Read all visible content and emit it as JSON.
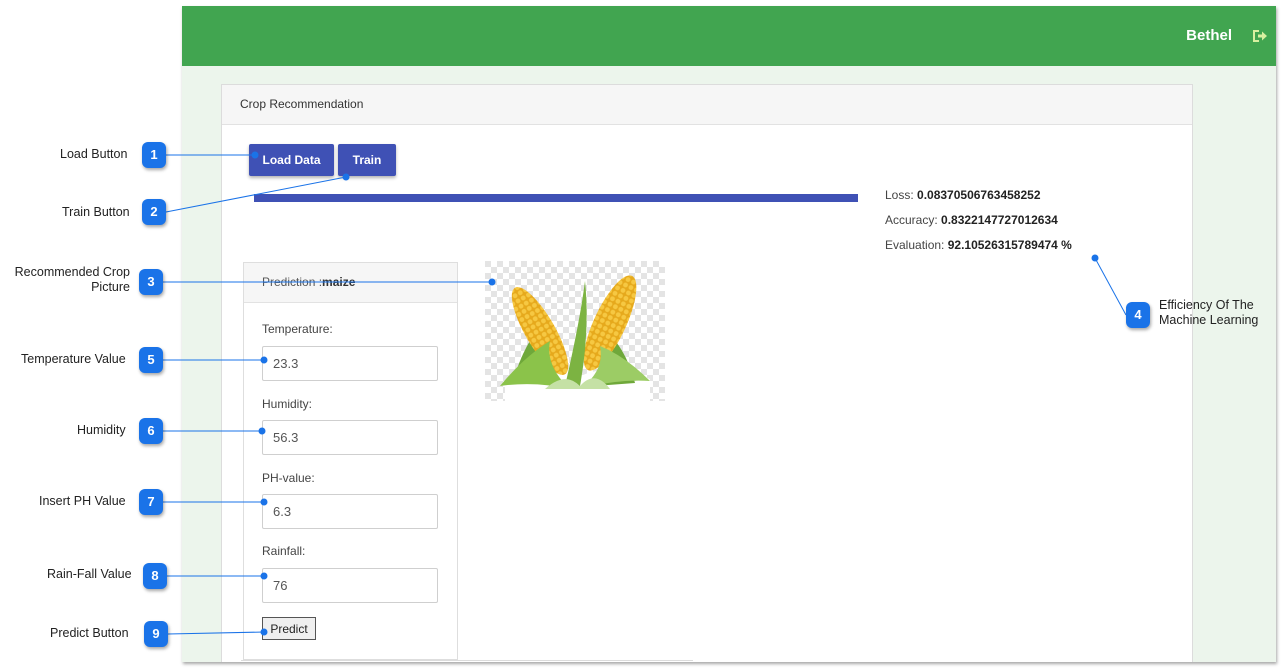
{
  "app": {
    "user_name": "Bethel",
    "card_title": "Crop Recommendation",
    "load_button": "Load Data",
    "train_button": "Train",
    "training_progress": 1.0,
    "metrics": {
      "loss_label": "Loss:",
      "loss_value": "0.08370506763458252",
      "accuracy_label": "Accuracy:",
      "accuracy_value": "0.8322147727012634",
      "evaluation_label": "Evaluation:",
      "evaluation_value": "92.10526315789474 %"
    },
    "prediction": {
      "label": "Prediction :",
      "value": "maize",
      "temperature_label": "Temperature:",
      "temperature_value": "23.3",
      "humidity_label": "Humidity:",
      "humidity_value": "56.3",
      "ph_label": "PH-value:",
      "ph_value": "6.3",
      "rainfall_label": "Rainfall:",
      "rainfall_value": "76",
      "predict_button": "Predict"
    }
  },
  "callouts": [
    {
      "number": "1",
      "label": "Load Button"
    },
    {
      "number": "2",
      "label": "Train Button"
    },
    {
      "number": "3",
      "label": "Recommended Crop\nPicture"
    },
    {
      "number": "4",
      "label": "Efficiency Of The\nMachine Learning"
    },
    {
      "number": "5",
      "label": "Temperature Value"
    },
    {
      "number": "6",
      "label": "Humidity"
    },
    {
      "number": "7",
      "label": "Insert PH Value"
    },
    {
      "number": "8",
      "label": "Rain-Fall Value"
    },
    {
      "number": "9",
      "label": "Predict Button"
    }
  ],
  "colors": {
    "header_green": "#41a550",
    "primary_blue": "#3f51b5",
    "badge_blue": "#1a73e8",
    "app_background": "#ecf5ec"
  }
}
